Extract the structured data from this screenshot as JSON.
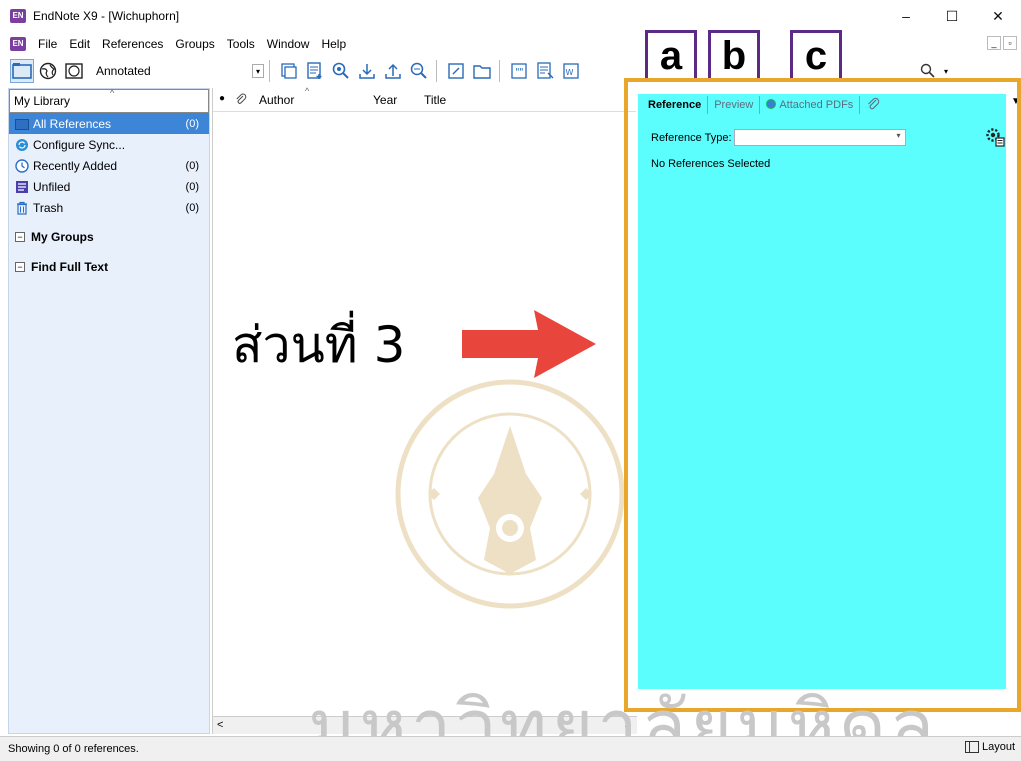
{
  "window": {
    "app_icon": "EN",
    "title": "EndNote X9 - [Wichuphorn]",
    "controls": [
      "–",
      "☐",
      "✕"
    ],
    "mdi_controls": [
      "_",
      "▫"
    ]
  },
  "menu": {
    "items": [
      "File",
      "Edit",
      "References",
      "Groups",
      "Tools",
      "Window",
      "Help"
    ]
  },
  "toolbar": {
    "style_label": "Annotated",
    "icons": [
      "local-library-icon",
      "online-search-icon",
      "integrated-library-icon",
      "new-reference-icon",
      "import-icon",
      "online-search-magnifier-icon",
      "download-icon",
      "upload-icon",
      "find-full-text-icon",
      "open-link-icon",
      "open-file-icon",
      "insert-citation-icon",
      "format-bibliography-icon",
      "word-icon",
      "search-icon"
    ]
  },
  "overlay_letters": [
    "a",
    "b",
    "c"
  ],
  "library": {
    "header": "My Library",
    "items": [
      {
        "label": "All References",
        "count": "(0)",
        "icon": "all-references-icon",
        "selected": true
      },
      {
        "label": "Configure Sync...",
        "count": "",
        "icon": "sync-icon",
        "selected": false
      },
      {
        "label": "Recently Added",
        "count": "(0)",
        "icon": "recently-added-icon",
        "selected": false
      },
      {
        "label": "Unfiled",
        "count": "(0)",
        "icon": "unfiled-icon",
        "selected": false
      },
      {
        "label": "Trash",
        "count": "(0)",
        "icon": "trash-icon",
        "selected": false
      }
    ],
    "groups": [
      {
        "toggle": "⊟",
        "label": "My Groups"
      },
      {
        "toggle": "⊟",
        "label": "Find Full Text"
      }
    ]
  },
  "list": {
    "columns": [
      "●",
      "Author",
      "Year",
      "Title"
    ]
  },
  "reference_panel": {
    "tabs": [
      "Reference",
      "Preview",
      "Attached PDFs"
    ],
    "ref_type_label": "Reference Type:",
    "ref_type_value": "",
    "empty_message": "No References Selected",
    "background": "#5cfdfd",
    "frame_color": "#e8a62a"
  },
  "annotation": {
    "caption": "ส่วนที่ 3",
    "arrow_color": "#e8453c"
  },
  "watermark": {
    "text": "มหาวิทยาลัยมหิดล"
  },
  "status": {
    "text": "Showing 0 of 0 references.",
    "layout_label": "Layout"
  }
}
